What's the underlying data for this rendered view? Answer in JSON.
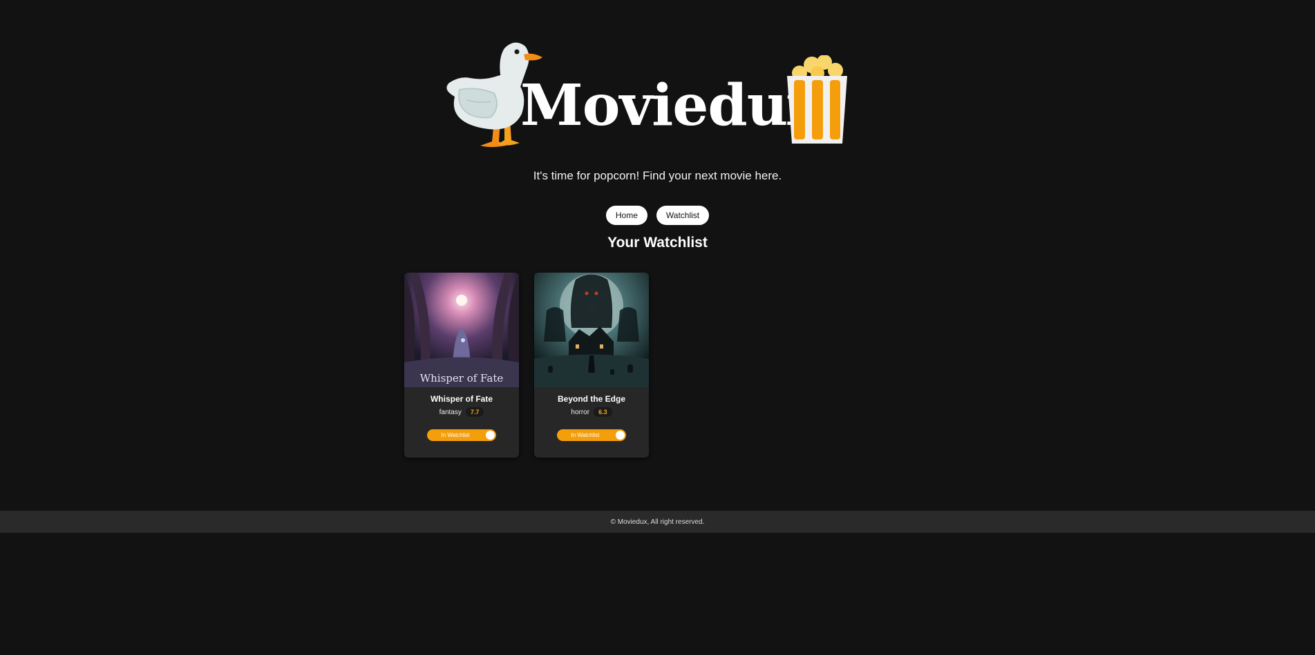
{
  "header": {
    "brand": "Moviedux",
    "tagline": "It's time for popcorn! Find your next movie here."
  },
  "nav": {
    "home_label": "Home",
    "watchlist_label": "Watchlist"
  },
  "main": {
    "section_title": "Your Watchlist",
    "movies": [
      {
        "title": "Whisper of Fate",
        "genre": "fantasy",
        "rating": "7.7",
        "toggle_label": "In Watchlist",
        "poster_icon": "forest-cloaked-figure-poster",
        "poster_caption": "Whisper of Fate"
      },
      {
        "title": "Beyond the Edge",
        "genre": "horror",
        "rating": "6.3",
        "toggle_label": "In Watchlist",
        "poster_icon": "haunted-house-moon-poster"
      }
    ]
  },
  "footer": {
    "copyright": "© Moviedux, All right reserved."
  },
  "colors": {
    "background": "#121212",
    "card": "#272727",
    "accent": "#f59e0b",
    "footer": "#2a2a2a"
  }
}
